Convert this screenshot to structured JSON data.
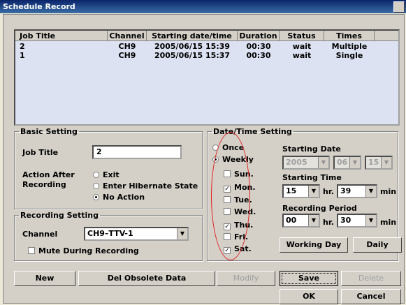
{
  "window": {
    "title": "Schedule Record"
  },
  "list": {
    "columns": [
      "Job Title",
      "Channel",
      "Starting date/time",
      "Duration",
      "Status",
      "Times"
    ],
    "rows": [
      {
        "job": "2",
        "channel": "CH9",
        "start": "2005/06/15 15:39",
        "duration": "00:30",
        "status": "wait",
        "times": "Multiple"
      },
      {
        "job": "1",
        "channel": "CH9",
        "start": "2005/06/15 15:37",
        "duration": "00:30",
        "status": "wait",
        "times": "Single"
      }
    ]
  },
  "basic": {
    "legend": "Basic Setting",
    "job_title_label": "Job Title",
    "job_title_value": "2",
    "action_label_1": "Action After",
    "action_label_2": "Recording",
    "actions": [
      "Exit",
      "Enter Hibernate State",
      "No Action"
    ],
    "action_selected": "No Action"
  },
  "recording": {
    "legend": "Recording Setting",
    "channel_label": "Channel",
    "channel_value": "CH9–TTV-1",
    "mute_label": "Mute During Recording"
  },
  "datetime": {
    "legend": "Date/Time Setting",
    "once": "Once",
    "weekly": "Weekly",
    "mode_selected": "Weekly",
    "days": [
      {
        "label": "Sun.",
        "checked": false
      },
      {
        "label": "Mon.",
        "checked": true
      },
      {
        "label": "Tue.",
        "checked": false
      },
      {
        "label": "Wed.",
        "checked": false
      },
      {
        "label": "Thu.",
        "checked": true
      },
      {
        "label": "Fri.",
        "checked": false
      },
      {
        "label": "Sat.",
        "checked": true
      }
    ],
    "starting_date_label": "Starting Date",
    "date_year": "2005",
    "date_month": "06",
    "date_day": "15",
    "starting_time_label": "Starting Time",
    "time_hour": "15",
    "time_min": "39",
    "period_label": "Recording Period",
    "period_hour": "00",
    "period_min": "30",
    "hr_unit": "hr.",
    "min_unit": "min",
    "working_day_btn": "Working Day",
    "daily_btn": "Daily"
  },
  "buttons": {
    "new": "New",
    "del_obsolete": "Del Obsolete Data",
    "modify": "Modify",
    "save": "Save",
    "delete": "Delete",
    "ok": "OK",
    "cancel": "Cancel"
  },
  "annotation_color": "#e02020"
}
